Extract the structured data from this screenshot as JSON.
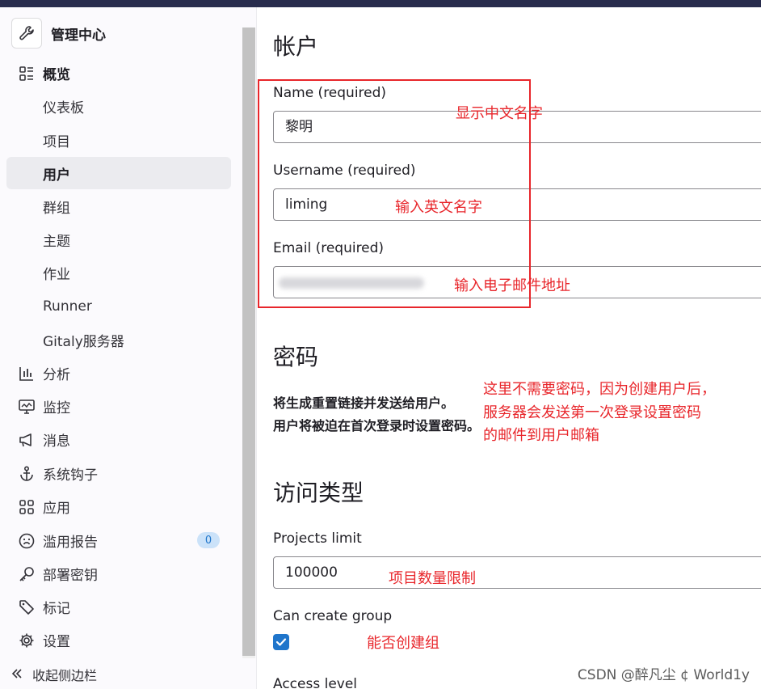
{
  "sidebar": {
    "title": "管理中心",
    "items": [
      {
        "label": "概览",
        "icon": "overview-icon"
      },
      {
        "label": "仪表板"
      },
      {
        "label": "项目"
      },
      {
        "label": "用户"
      },
      {
        "label": "群组"
      },
      {
        "label": "主题"
      },
      {
        "label": "作业"
      },
      {
        "label": "Runner"
      },
      {
        "label": "Gitaly服务器"
      },
      {
        "label": "分析",
        "icon": "chart-icon"
      },
      {
        "label": "监控",
        "icon": "monitor-icon"
      },
      {
        "label": "消息",
        "icon": "megaphone-icon"
      },
      {
        "label": "系统钩子",
        "icon": "anchor-icon"
      },
      {
        "label": "应用",
        "icon": "apps-grid-icon"
      },
      {
        "label": "滥用报告",
        "icon": "frown-face-icon",
        "badge": "0"
      },
      {
        "label": "部署密钥",
        "icon": "key-icon"
      },
      {
        "label": "标记",
        "icon": "label-tag-icon"
      },
      {
        "label": "设置",
        "icon": "gear-icon"
      }
    ],
    "collapse_label": "收起侧边栏"
  },
  "account": {
    "heading": "帐户",
    "name_label": "Name (required)",
    "name_value": "黎明",
    "username_label": "Username (required)",
    "username_value": "liming",
    "email_label": "Email (required)"
  },
  "password": {
    "heading": "密码",
    "note_line1": "将生成重置链接并发送给用户。",
    "note_line2": "用户将被迫在首次登录时设置密码。"
  },
  "access": {
    "heading": "访问类型",
    "projects_limit_label": "Projects limit",
    "projects_limit_value": "100000",
    "can_create_group_label": "Can create group",
    "can_create_group_checked": true,
    "access_level_label": "Access level"
  },
  "annotations": {
    "name_note": "显示中文名字",
    "username_note": "输入英文名字",
    "email_note": "输入电子邮件地址",
    "password_note_1": "这里不需要密码，因为创建用户后，",
    "password_note_2": "服务器会发送第一次登录设置密码",
    "password_note_3": "的邮件到用户邮箱",
    "projects_limit_note": "项目数量限制",
    "create_group_note": "能否创建组"
  },
  "watermark": "CSDN @醉凡尘 ¢  World1y",
  "colors": {
    "topbar": "#282c4d",
    "active_bg": "#ebebef",
    "annotation_red": "#e8262b",
    "checkbox_blue": "#1f75cb"
  }
}
